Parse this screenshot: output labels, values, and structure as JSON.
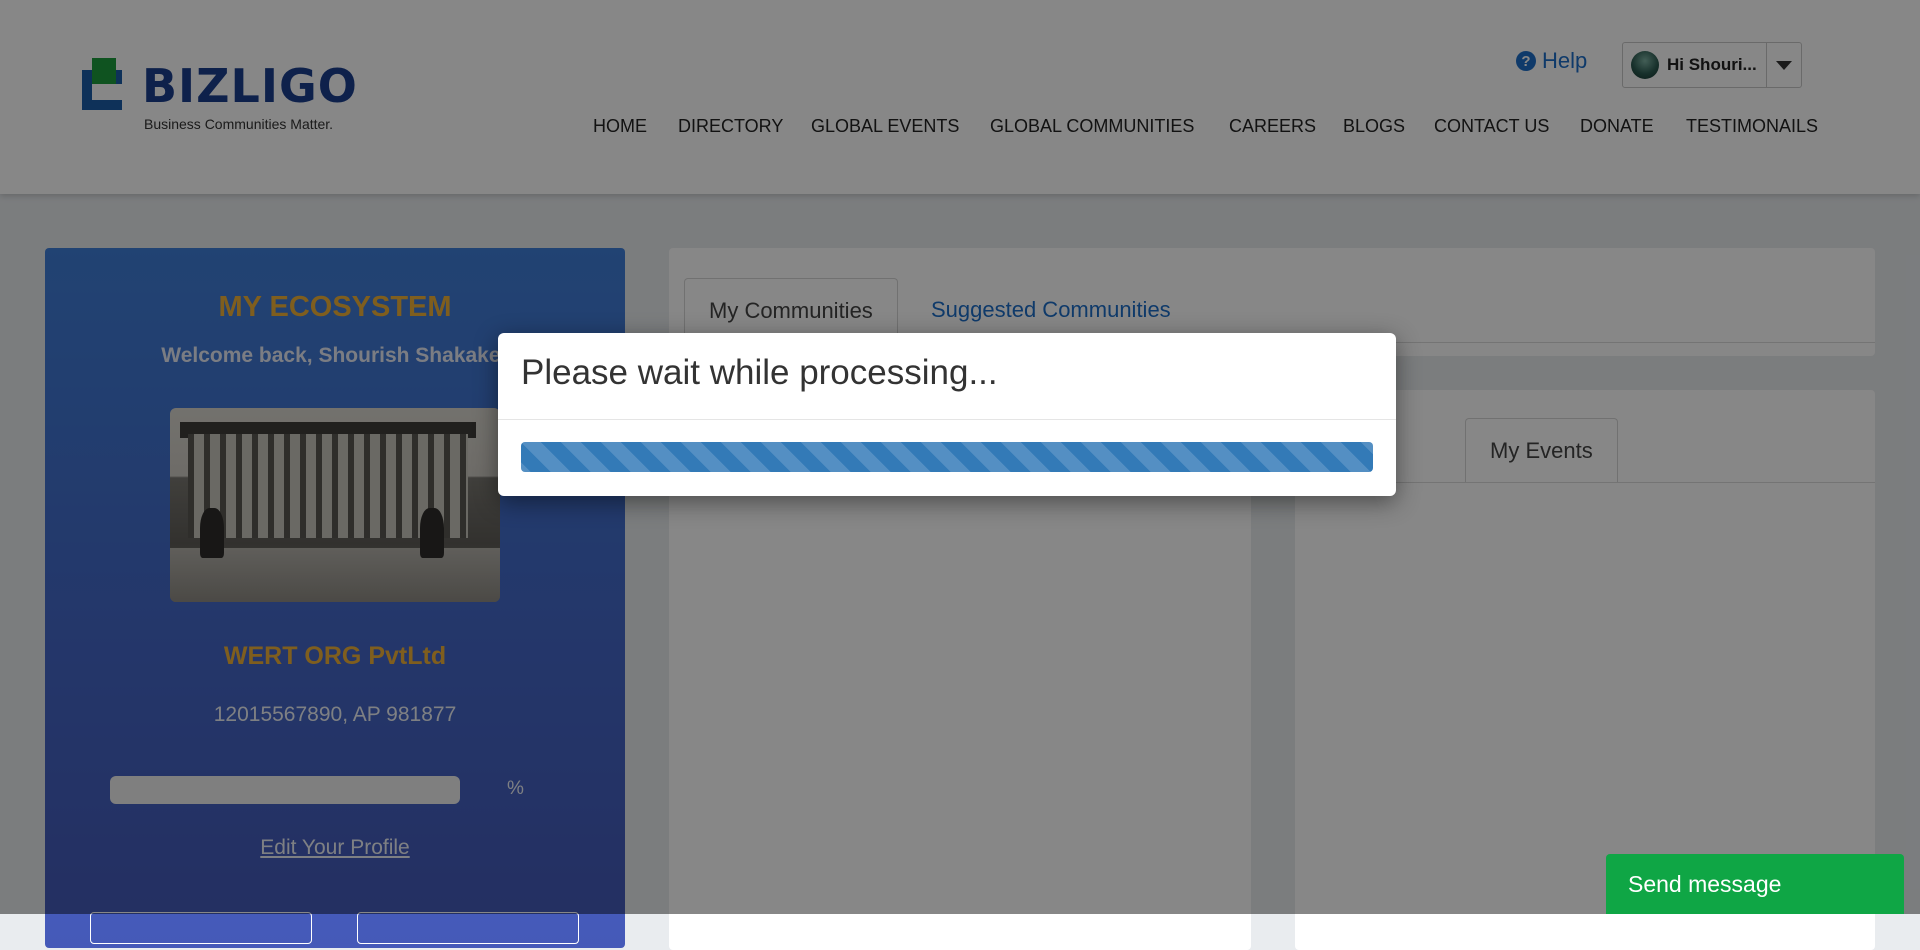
{
  "header": {
    "logo_text": "BIZLIGO",
    "logo_tagline": "Business Communities Matter.",
    "help_label": "Help",
    "user_label": "Hi Shouri...",
    "nav": [
      "HOME",
      "DIRECTORY",
      "GLOBAL EVENTS",
      "GLOBAL COMMUNITIES",
      "CAREERS",
      "BLOGS",
      "CONTACT US",
      "DONATE",
      "TESTIMONAILS"
    ]
  },
  "sidebar": {
    "title": "MY ECOSYSTEM",
    "welcome": "Welcome back, Shourish Shakaker",
    "org_name": "WERT ORG PvtLtd",
    "phone": "12015567890, AP 981877",
    "percent_sign": "%",
    "edit_profile": "Edit Your Profile"
  },
  "main": {
    "tabs": [
      "My Communities",
      "Suggested Communities"
    ],
    "events_tab": "My Events"
  },
  "modal": {
    "title": "Please wait while processing...",
    "progress": 1.0
  },
  "chat": {
    "label": "Send message"
  },
  "colors": {
    "accent": "#1e6fc9",
    "panel": "#4468c9",
    "highlight": "#f0b23a",
    "progress": "#337ab7",
    "chat": "#0fa645"
  },
  "icons": [
    "help-icon",
    "avatar",
    "chevron-down-icon"
  ]
}
